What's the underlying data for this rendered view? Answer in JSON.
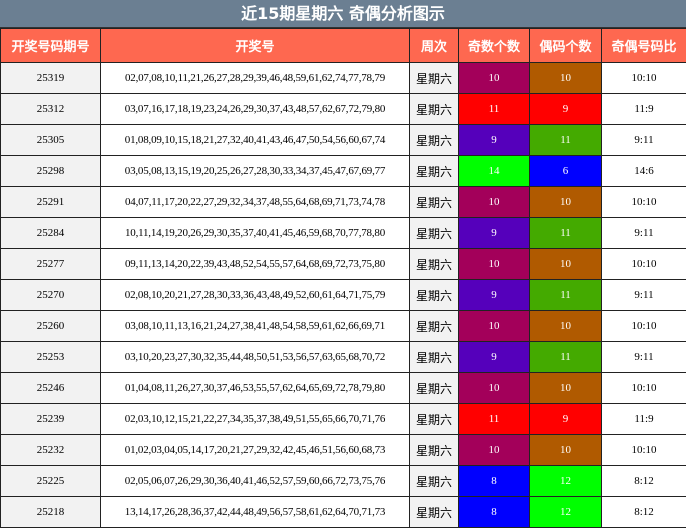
{
  "title": "近15期星期六 奇偶分析图示",
  "headers": {
    "period": "开奖号码期号",
    "numbers": "开奖号",
    "week": "周次",
    "odd": "奇数个数",
    "even": "偶码个数",
    "ratio": "奇偶号码比"
  },
  "colors": {
    "header_bg": "#fe6850",
    "title_bg": "#6b7f92",
    "odd_10": "#a3005a",
    "even_10": "#b05a00",
    "odd_11": "#ff0000",
    "even_9": "#ff0000",
    "odd_9": "#5500bb",
    "even_11": "#44aa00",
    "odd_14": "#00ff00",
    "even_6": "#0000ff",
    "odd_8": "#0000ff",
    "even_12": "#00ff00"
  },
  "rows": [
    {
      "period": "25319",
      "numbers": "02,07,08,10,11,21,26,27,28,29,39,46,48,59,61,62,74,77,78,79",
      "week": "星期六",
      "odd": "10",
      "even": "10",
      "ratio": "10:10"
    },
    {
      "period": "25312",
      "numbers": "03,07,16,17,18,19,23,24,26,29,30,37,43,48,57,62,67,72,79,80",
      "week": "星期六",
      "odd": "11",
      "even": "9",
      "ratio": "11:9"
    },
    {
      "period": "25305",
      "numbers": "01,08,09,10,15,18,21,27,32,40,41,43,46,47,50,54,56,60,67,74",
      "week": "星期六",
      "odd": "9",
      "even": "11",
      "ratio": "9:11"
    },
    {
      "period": "25298",
      "numbers": "03,05,08,13,15,19,20,25,26,27,28,30,33,34,37,45,47,67,69,77",
      "week": "星期六",
      "odd": "14",
      "even": "6",
      "ratio": "14:6"
    },
    {
      "period": "25291",
      "numbers": "04,07,11,17,20,22,27,29,32,34,37,48,55,64,68,69,71,73,74,78",
      "week": "星期六",
      "odd": "10",
      "even": "10",
      "ratio": "10:10"
    },
    {
      "period": "25284",
      "numbers": "10,11,14,19,20,26,29,30,35,37,40,41,45,46,59,68,70,77,78,80",
      "week": "星期六",
      "odd": "9",
      "even": "11",
      "ratio": "9:11"
    },
    {
      "period": "25277",
      "numbers": "09,11,13,14,20,22,39,43,48,52,54,55,57,64,68,69,72,73,75,80",
      "week": "星期六",
      "odd": "10",
      "even": "10",
      "ratio": "10:10"
    },
    {
      "period": "25270",
      "numbers": "02,08,10,20,21,27,28,30,33,36,43,48,49,52,60,61,64,71,75,79",
      "week": "星期六",
      "odd": "9",
      "even": "11",
      "ratio": "9:11"
    },
    {
      "period": "25260",
      "numbers": "03,08,10,11,13,16,21,24,27,38,41,48,54,58,59,61,62,66,69,71",
      "week": "星期六",
      "odd": "10",
      "even": "10",
      "ratio": "10:10"
    },
    {
      "period": "25253",
      "numbers": "03,10,20,23,27,30,32,35,44,48,50,51,53,56,57,63,65,68,70,72",
      "week": "星期六",
      "odd": "9",
      "even": "11",
      "ratio": "9:11"
    },
    {
      "period": "25246",
      "numbers": "01,04,08,11,26,27,30,37,46,53,55,57,62,64,65,69,72,78,79,80",
      "week": "星期六",
      "odd": "10",
      "even": "10",
      "ratio": "10:10"
    },
    {
      "period": "25239",
      "numbers": "02,03,10,12,15,21,22,27,34,35,37,38,49,51,55,65,66,70,71,76",
      "week": "星期六",
      "odd": "11",
      "even": "9",
      "ratio": "11:9"
    },
    {
      "period": "25232",
      "numbers": "01,02,03,04,05,14,17,20,21,27,29,32,42,45,46,51,56,60,68,73",
      "week": "星期六",
      "odd": "10",
      "even": "10",
      "ratio": "10:10"
    },
    {
      "period": "25225",
      "numbers": "02,05,06,07,26,29,30,36,40,41,46,52,57,59,60,66,72,73,75,76",
      "week": "星期六",
      "odd": "8",
      "even": "12",
      "ratio": "8:12"
    },
    {
      "period": "25218",
      "numbers": "13,14,17,26,28,36,37,42,44,48,49,56,57,58,61,62,64,70,71,73",
      "week": "星期六",
      "odd": "8",
      "even": "12",
      "ratio": "8:12"
    }
  ]
}
